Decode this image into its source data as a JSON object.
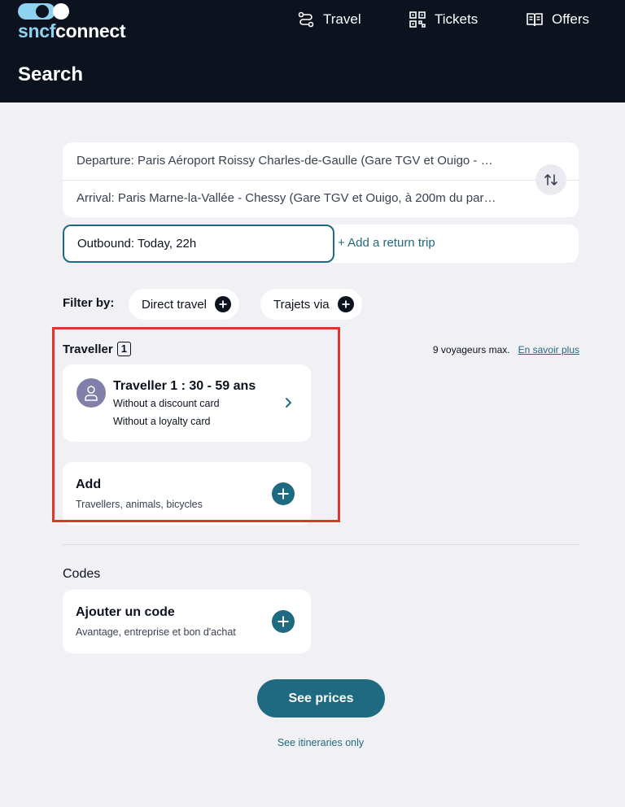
{
  "brand": {
    "prefix": "sncf",
    "suffix": "connect"
  },
  "nav": [
    {
      "label": "Travel",
      "icon": "route-icon"
    },
    {
      "label": "Tickets",
      "icon": "qr-code-icon"
    },
    {
      "label": "Offers",
      "icon": "book-icon"
    }
  ],
  "page_title": "Search",
  "journey": {
    "departure": "Departure: Paris Aéroport Roissy Charles-de-Gaulle (Gare TGV et Ouigo - …",
    "arrival": "Arrival: Paris Marne-la-Vallée - Chessy (Gare TGV et Ouigo, à 200m du par…",
    "outbound": "Outbound: Today, 22h",
    "return_label": "+ Add a return trip"
  },
  "filters": {
    "label": "Filter by:",
    "chips": [
      "Direct travel",
      "Trajets via"
    ]
  },
  "travellers": {
    "label": "Traveller",
    "count": "1",
    "max_info": "9 voyageurs max.",
    "learn_more": "En savoir plus",
    "traveller": {
      "name": "Traveller 1 :  30 - 59 ans",
      "discount": "Without a discount card",
      "loyalty": "Without a loyalty card"
    },
    "add": {
      "title": "Add",
      "subtitle": "Travellers, animals, bicycles"
    }
  },
  "codes": {
    "label": "Codes",
    "title": "Ajouter un code",
    "subtitle": "Avantage, entreprise et bon d'achat"
  },
  "actions": {
    "see_prices": "See prices",
    "itineraries_only": "See itineraries only"
  },
  "colors": {
    "header": "#0c131f",
    "accent": "#1e6a80",
    "highlight": "#e0352b",
    "avatar": "#817fa8"
  }
}
